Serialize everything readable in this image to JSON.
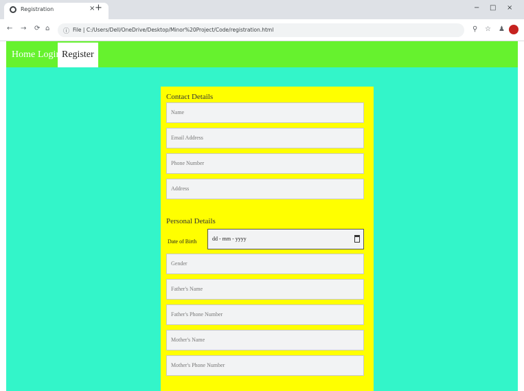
{
  "browser": {
    "tab_title": "Registration",
    "tab_close": "×",
    "new_tab": "+",
    "url": "File | C:/Users/Dell/OneDrive/Desktop/Minor%20Project/Code/registration.html",
    "window_controls": {
      "minimize": "−",
      "maximize": "□",
      "close": "×"
    }
  },
  "nav": {
    "home": "Home",
    "login": "Login",
    "register": "Register"
  },
  "form": {
    "contact_title": "Contact Details",
    "personal_title": "Personal Details",
    "contact_fields": [
      {
        "placeholder": "Name"
      },
      {
        "placeholder": "Email Address"
      },
      {
        "placeholder": "Phone Number"
      },
      {
        "placeholder": "Address"
      }
    ],
    "dob_label": "Date of Birth",
    "dob_placeholder": "dd - mm - yyyy",
    "personal_fields": [
      {
        "placeholder": "Gender"
      },
      {
        "placeholder": "Father's Name"
      },
      {
        "placeholder": "Father's Phone Number"
      },
      {
        "placeholder": "Mother's Name"
      },
      {
        "placeholder": "Mother's Phone Number"
      }
    ]
  },
  "colors": {
    "page_background": "#33f5c9",
    "navbar": "#66f22e",
    "form_background": "#ffff00",
    "field_background": "#f2f3f4"
  }
}
